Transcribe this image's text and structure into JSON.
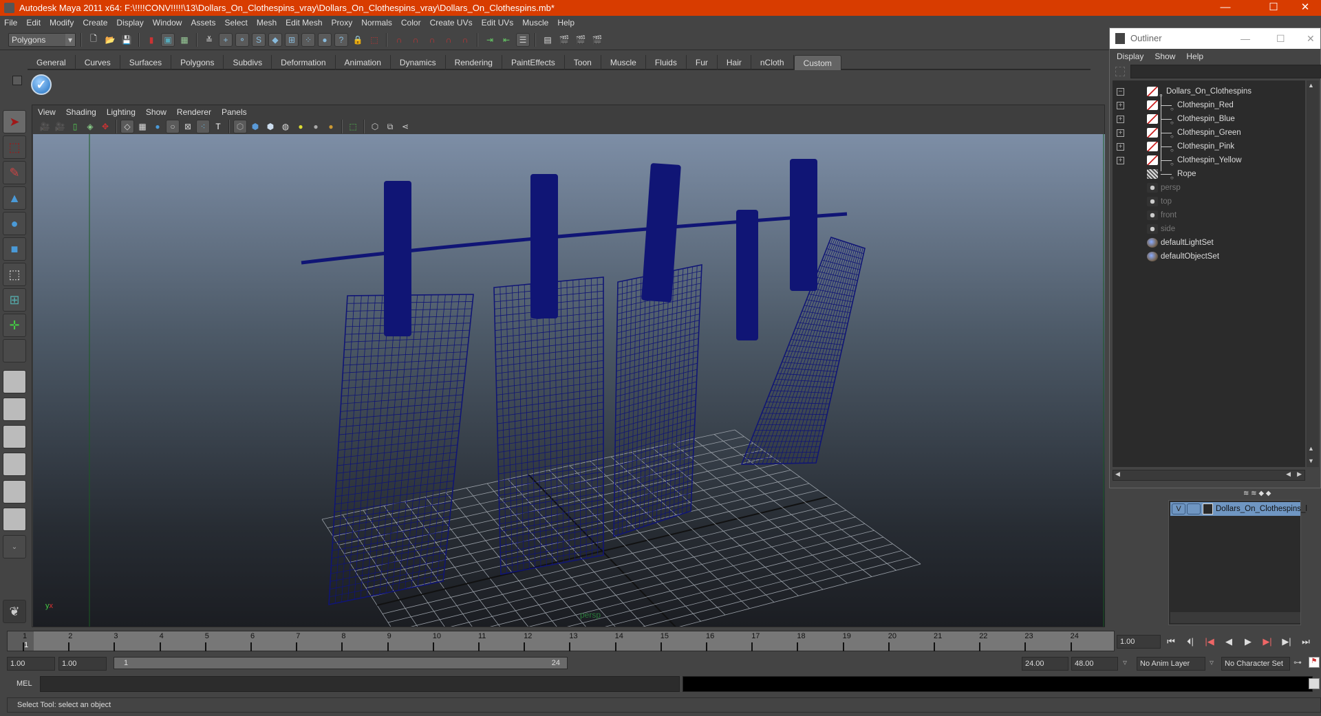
{
  "window": {
    "title": "Autodesk Maya 2011 x64: F:\\!!!!CONV!!!!!\\13\\Dollars_On_Clothespins_vray\\Dollars_On_Clothespins_vray\\Dollars_On_Clothespins.mb*",
    "minimize": "—",
    "maximize": "☐",
    "close": "✕"
  },
  "menu": [
    "File",
    "Edit",
    "Modify",
    "Create",
    "Display",
    "Window",
    "Assets",
    "Select",
    "Mesh",
    "Edit Mesh",
    "Proxy",
    "Normals",
    "Color",
    "Create UVs",
    "Edit UVs",
    "Muscle",
    "Help"
  ],
  "status_line": {
    "mode": "Polygons"
  },
  "shelf": {
    "tabs": [
      "General",
      "Curves",
      "Surfaces",
      "Polygons",
      "Subdivs",
      "Deformation",
      "Animation",
      "Dynamics",
      "Rendering",
      "PaintEffects",
      "Toon",
      "Muscle",
      "Fluids",
      "Fur",
      "Hair",
      "nCloth",
      "Custom"
    ],
    "active_tab": "Custom"
  },
  "panel": {
    "menu": [
      "View",
      "Shading",
      "Lighting",
      "Show",
      "Renderer",
      "Panels"
    ],
    "camera_label": "persp"
  },
  "timeline": {
    "ticks": [
      "1",
      "2",
      "3",
      "4",
      "5",
      "6",
      "7",
      "8",
      "9",
      "10",
      "11",
      "12",
      "13",
      "14",
      "15",
      "16",
      "17",
      "18",
      "19",
      "20",
      "21",
      "22",
      "23",
      "24"
    ],
    "current_marker": "1",
    "current_frame": "1.00"
  },
  "range": {
    "start": "1.00",
    "anim_start": "1.00",
    "slider_start": "1",
    "slider_end": "24",
    "end": "24.00",
    "anim_end": "48.00",
    "anim_layer": "No Anim Layer",
    "character_set": "No Character Set"
  },
  "command_line": {
    "label": "MEL",
    "value": ""
  },
  "help_line": "Select Tool: select an object",
  "outliner": {
    "title": "Outliner",
    "menu": [
      "Display",
      "Show",
      "Help"
    ],
    "items": [
      {
        "label": "Dollars_On_Clothespins",
        "expander": "−",
        "icon": "transform-icon",
        "level": 0,
        "dim": false
      },
      {
        "label": "Clothespin_Red",
        "expander": "+",
        "icon": "transform-icon",
        "level": 1,
        "dim": false
      },
      {
        "label": "Clothespin_Blue",
        "expander": "+",
        "icon": "transform-icon",
        "level": 1,
        "dim": false
      },
      {
        "label": "Clothespin_Green",
        "expander": "+",
        "icon": "transform-icon",
        "level": 1,
        "dim": false
      },
      {
        "label": "Clothespin_Pink",
        "expander": "+",
        "icon": "transform-icon",
        "level": 1,
        "dim": false
      },
      {
        "label": "Clothespin_Yellow",
        "expander": "+",
        "icon": "transform-icon",
        "level": 1,
        "dim": false
      },
      {
        "label": "Rope",
        "expander": "",
        "icon": "mesh-icon",
        "level": 1,
        "dim": false
      },
      {
        "label": "persp",
        "expander": "",
        "icon": "camera-icon",
        "level": 0,
        "dim": true
      },
      {
        "label": "top",
        "expander": "",
        "icon": "camera-icon",
        "level": 0,
        "dim": true
      },
      {
        "label": "front",
        "expander": "",
        "icon": "camera-icon",
        "level": 0,
        "dim": true
      },
      {
        "label": "side",
        "expander": "",
        "icon": "camera-icon",
        "level": 0,
        "dim": true
      },
      {
        "label": "defaultLightSet",
        "expander": "",
        "icon": "set-icon",
        "level": 0,
        "dim": false
      },
      {
        "label": "defaultObjectSet",
        "expander": "",
        "icon": "set-icon",
        "level": 0,
        "dim": false
      }
    ]
  },
  "layers": {
    "items": [
      {
        "visible": "V",
        "name": "Dollars_On_Clothespins_l"
      }
    ]
  },
  "colors": {
    "title_bar": "#d83c00",
    "wireframe": "#101575",
    "layer_selected": "#6f96c2"
  }
}
